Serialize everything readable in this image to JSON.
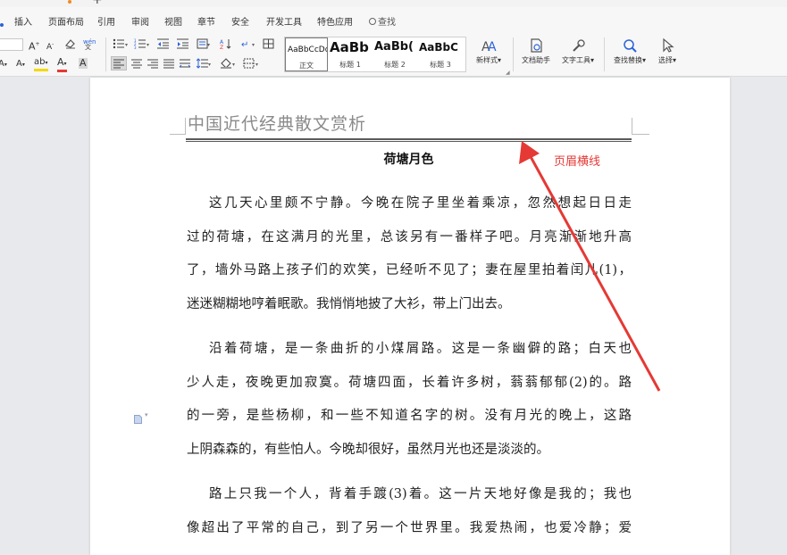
{
  "tabs": {
    "insert": "插入",
    "page_layout": "页面布局",
    "references": "引用",
    "review": "审阅",
    "view": "视图",
    "chapter": "章节",
    "security": "安全",
    "developer": "开发工具",
    "special_apps": "特色应用",
    "search": "查找"
  },
  "ribbon": {
    "styles": [
      {
        "sample": "AaBbCcDd",
        "name": "正文"
      },
      {
        "sample": "AaBb",
        "name": "标题 1"
      },
      {
        "sample": "AaBb(",
        "name": "标题 2"
      },
      {
        "sample": "AaBbC",
        "name": "标题 3"
      }
    ],
    "new_style": "新样式",
    "doc_assistant": "文档助手",
    "text_tools": "文字工具",
    "find_replace": "查找替换",
    "select": "选择",
    "font_grow": "A",
    "font_shrink": "A",
    "text_bg": "A",
    "text_color": "A",
    "char_shading": "A",
    "hilite": "ab"
  },
  "document": {
    "header_text": "中国近代经典散文赏析",
    "title": "荷塘月色",
    "paragraphs": [
      [
        "这几天心里颇不宁静。今晚在院子里坐着乘凉，忽然想起日日走",
        "过的荷塘，在这满月的光里，总该另有一番样子吧。月亮渐渐地升高",
        "了，墙外马路上孩子们的欢笑，已经听不见了；妻在屋里拍着闰儿(1)，",
        "迷迷糊糊地哼着眠歌。我悄悄地披了大衫，带上门出去。"
      ],
      [
        "沿着荷塘，是一条曲折的小煤屑路。这是一条幽僻的路；白天也",
        "少人走，夜晚更加寂寞。荷塘四面，长着许多树，蓊蓊郁郁(2)的。路",
        "的一旁，是些杨柳，和一些不知道名字的树。没有月光的晚上，这路",
        "上阴森森的，有些怕人。今晚却很好，虽然月光也还是淡淡的。"
      ],
      [
        "路上只我一个人，背着手踱(3)着。这一片天地好像是我的；我也",
        "像超出了平常的自己，到了另一个世界里。我爱热闹，也爱冷静；爱"
      ]
    ]
  },
  "annotation": {
    "label": "页眉横线",
    "color": "#e53935"
  },
  "colors": {
    "accent_blue": "#2b62d9",
    "header_text": "#8a8a8a"
  }
}
